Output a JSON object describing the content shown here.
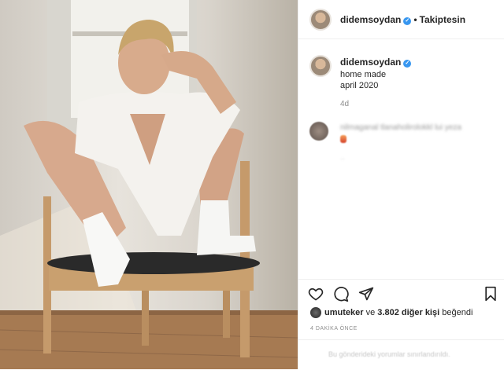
{
  "header": {
    "username": "didemsoydan",
    "separator": "•",
    "follow_status": "Takiptesin"
  },
  "caption": {
    "username": "didemsoydan",
    "lines": [
      "home made",
      "april 2020"
    ],
    "time": "4d"
  },
  "comment": {
    "text_blurred": "nilmaganal tlanaholirolokkl lui yeza"
  },
  "actions": {
    "icons": [
      "heart-icon",
      "comment-icon",
      "share-icon",
      "bookmark-icon"
    ]
  },
  "likes": {
    "first_liker": "umuteker",
    "connector": "ve",
    "others": "3.802 diğer kişi",
    "suffix": "beğendi"
  },
  "posted_ago": "4 DAKİKA ÖNCE",
  "footer_note": "Bu gönderideki yorumlar sınırlandırıldı.",
  "colors": {
    "verified": "#3897f0",
    "text": "#262626",
    "muted": "#8e8e8e",
    "border": "#efefef"
  }
}
